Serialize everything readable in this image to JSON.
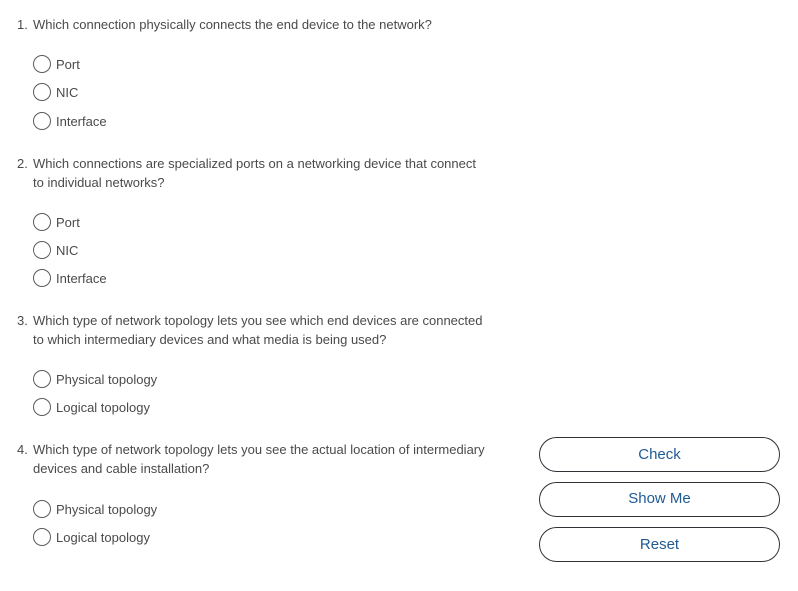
{
  "questions": [
    {
      "number": "1.",
      "lines": [
        "Which connection physically connects the end device to the network?"
      ],
      "options": [
        "Port",
        "NIC",
        "Interface"
      ]
    },
    {
      "number": "2.",
      "lines": [
        "Which connections are specialized ports on a networking device that connect",
        "to individual networks?"
      ],
      "options": [
        "Port",
        "NIC",
        "Interface"
      ]
    },
    {
      "number": "3.",
      "lines": [
        "Which type of network topology lets you see which end devices are connected",
        "to which intermediary devices and what media is being used?"
      ],
      "options": [
        "Physical topology",
        "Logical topology"
      ]
    },
    {
      "number": "4.",
      "lines": [
        "Which type of network topology lets you see the actual location of intermediary",
        "devices and cable installation?"
      ],
      "options": [
        "Physical topology",
        "Logical topology"
      ]
    }
  ],
  "buttons": {
    "check": "Check",
    "show_me": "Show Me",
    "reset": "Reset"
  }
}
